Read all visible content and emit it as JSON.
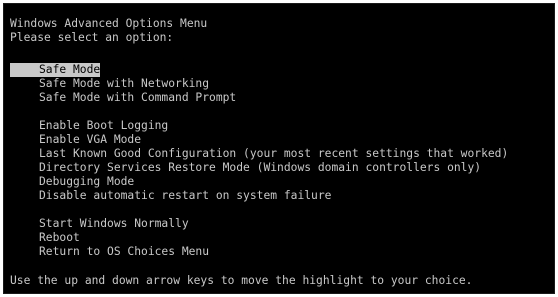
{
  "header": {
    "title": "Windows Advanced Options Menu",
    "prompt": "Please select an option:"
  },
  "menu": {
    "group1": [
      {
        "label": "Safe Mode",
        "selected": true
      },
      {
        "label": "Safe Mode with Networking",
        "selected": false
      },
      {
        "label": "Safe Mode with Command Prompt",
        "selected": false
      }
    ],
    "group2": [
      {
        "label": "Enable Boot Logging"
      },
      {
        "label": "Enable VGA Mode"
      },
      {
        "label": "Last Known Good Configuration (your most recent settings that worked)"
      },
      {
        "label": "Directory Services Restore Mode (Windows domain controllers only)"
      },
      {
        "label": "Debugging Mode"
      },
      {
        "label": "Disable automatic restart on system failure"
      }
    ],
    "group3": [
      {
        "label": "Start Windows Normally"
      },
      {
        "label": "Reboot"
      },
      {
        "label": "Return to OS Choices Menu"
      }
    ]
  },
  "footer": {
    "instructions": "Use the up and down arrow keys to move the highlight to your choice."
  },
  "colors": {
    "background": "#000000",
    "text": "#c8c8c8",
    "highlight": "#c8c8c8"
  }
}
